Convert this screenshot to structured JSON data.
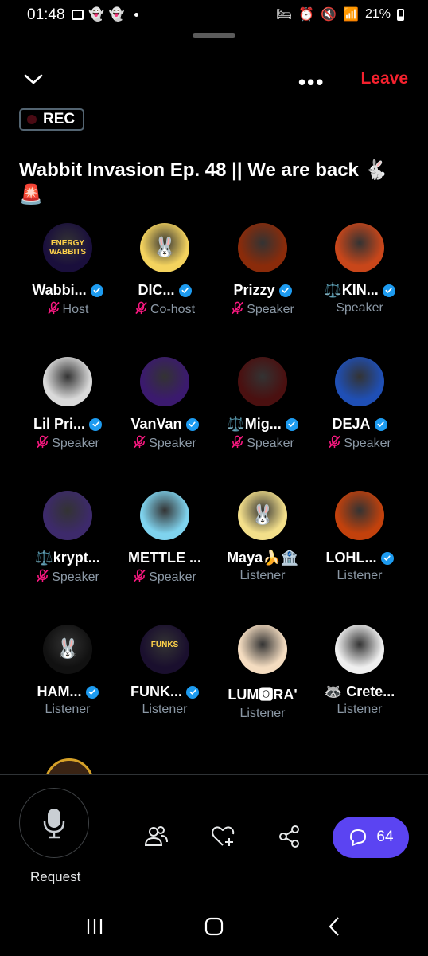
{
  "status": {
    "time": "01:48",
    "battery": "21%"
  },
  "header": {
    "leave_label": "Leave",
    "more_label": "•••"
  },
  "recording": {
    "label": "REC"
  },
  "space": {
    "title": "Wabbit Invasion Ep. 48 || We are back 🐇🚨"
  },
  "participants": [
    {
      "name": "Wabbi...",
      "role": "Host",
      "verified": true,
      "muted": true,
      "avatar_text": "ENERGY WABBITS",
      "color": "#1a0f3c"
    },
    {
      "name": "DIC...",
      "role": "Co-host",
      "verified": true,
      "muted": true,
      "avatar_text": "🐰",
      "color": "#f4d35e"
    },
    {
      "name": "Prizzy",
      "role": "Speaker",
      "verified": true,
      "muted": true,
      "avatar_text": "",
      "color": "#8a2b0a"
    },
    {
      "name": "⚖️KIN...",
      "role": "Speaker",
      "verified": true,
      "muted": false,
      "avatar_text": "",
      "color": "#c8461a"
    },
    {
      "name": "Lil Pri...",
      "role": "Speaker",
      "verified": true,
      "muted": true,
      "avatar_text": "",
      "color": "#d9d9d9"
    },
    {
      "name": "VanVan",
      "role": "Speaker",
      "verified": true,
      "muted": true,
      "avatar_text": "",
      "color": "#3b1a6e"
    },
    {
      "name": "⚖️Mig...",
      "role": "Speaker",
      "verified": true,
      "muted": true,
      "avatar_text": "",
      "color": "#4a1010"
    },
    {
      "name": "DEJA",
      "role": "Speaker",
      "verified": true,
      "muted": true,
      "avatar_text": "",
      "color": "#1f4fb5"
    },
    {
      "name": "⚖️krypt...",
      "role": "Speaker",
      "verified": false,
      "muted": true,
      "avatar_text": "",
      "color": "#3d2a6b"
    },
    {
      "name": "METTLE ...",
      "role": "Speaker",
      "verified": false,
      "muted": true,
      "avatar_text": "",
      "color": "#7fd3ee"
    },
    {
      "name": "Maya🍌🏦",
      "role": "Listener",
      "verified": false,
      "muted": false,
      "avatar_text": "🐰",
      "color": "#f3df8a"
    },
    {
      "name": "LOHL...",
      "role": "Listener",
      "verified": true,
      "muted": false,
      "avatar_text": "",
      "color": "#c2410c"
    },
    {
      "name": "HAM...",
      "role": "Listener",
      "verified": true,
      "muted": false,
      "avatar_text": "🐰",
      "color": "#111111"
    },
    {
      "name": "FUNK...",
      "role": "Listener",
      "verified": true,
      "muted": false,
      "avatar_text": "FUNKS",
      "color": "#1a0f2e"
    },
    {
      "name": "LUM🅾RA'",
      "role": "Listener",
      "verified": false,
      "muted": false,
      "avatar_text": "",
      "color": "#f4dcc0"
    },
    {
      "name": "🦝 Crete...",
      "role": "Listener",
      "verified": false,
      "muted": false,
      "avatar_text": "",
      "color": "#efefef"
    }
  ],
  "bottom": {
    "request_label": "Request",
    "chat_count": "64"
  },
  "icons": {
    "chevron": "chevron-down-icon",
    "more": "more-icon",
    "mic": "microphone-icon",
    "people": "people-icon",
    "heart": "heart-plus-icon",
    "share": "share-icon",
    "chat": "chat-icon"
  },
  "colors": {
    "accent": "#1d9bf0",
    "leave": "#f4212e",
    "chat_bg": "#5b44f2",
    "mute": "#f91880"
  }
}
